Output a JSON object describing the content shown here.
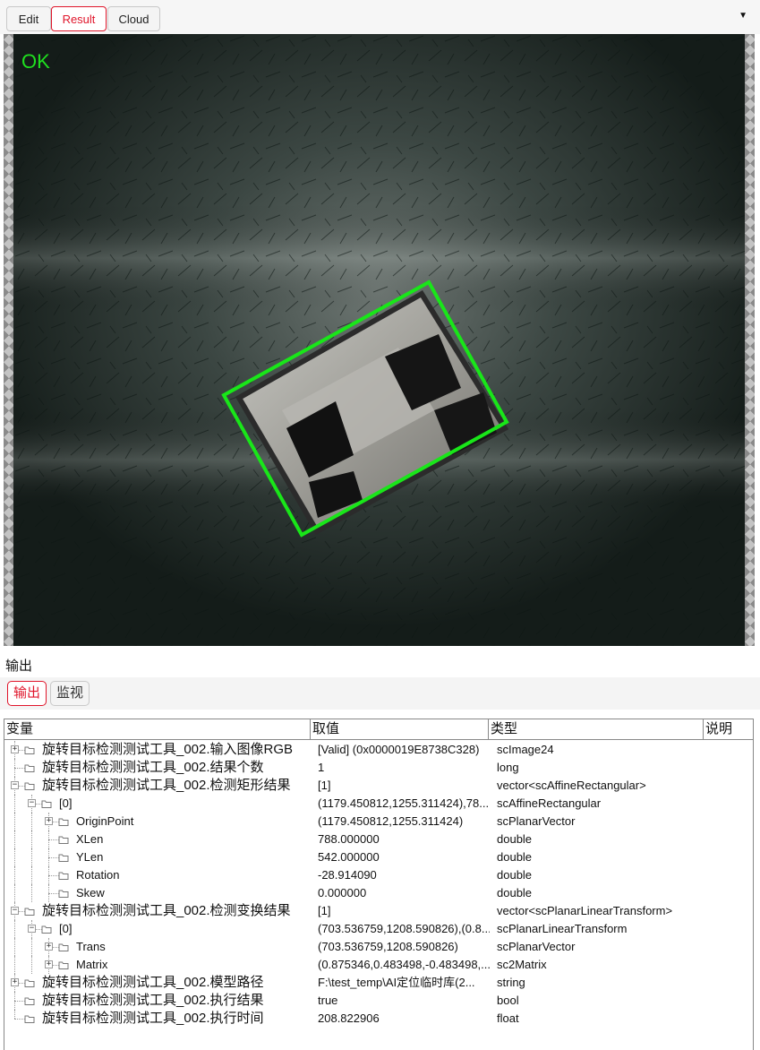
{
  "tabs": [
    {
      "label": "Edit",
      "active": false
    },
    {
      "label": "Result",
      "active": true
    },
    {
      "label": "Cloud",
      "active": false
    }
  ],
  "dropdown_icon": "chevron-down-icon",
  "viewer": {
    "status_text": "OK",
    "status_color": "#1fe01f",
    "box_color": "#19e619",
    "background_color": "#1f2a26"
  },
  "output": {
    "section_title": "输出",
    "subtabs": [
      {
        "label": "输出",
        "active": true
      },
      {
        "label": "监视",
        "active": false
      }
    ],
    "columns": [
      "变量",
      "取值",
      "类型",
      "说明"
    ],
    "rows": [
      {
        "name": "旋转目标检测测试工具_002.输入图像RGB",
        "value": "[Valid] (0x0000019E8738C328)",
        "type": "scImage24",
        "expandable": true,
        "expanded": false
      },
      {
        "name": "旋转目标检测测试工具_002.结果个数",
        "value": "1",
        "type": "long",
        "expandable": false,
        "expanded": false
      },
      {
        "name": "旋转目标检测测试工具_002.检测矩形结果",
        "value": "[1]",
        "type": "vector<scAffineRectangular>",
        "expandable": true,
        "expanded": true
      },
      {
        "name": "[0]",
        "value": "(1179.450812,1255.311424),78...",
        "type": "scAffineRectangular",
        "expandable": true,
        "expanded": true
      },
      {
        "name": "OriginPoint",
        "value": "(1179.450812,1255.311424)",
        "type": "scPlanarVector",
        "expandable": true,
        "expanded": false
      },
      {
        "name": "XLen",
        "value": "788.000000",
        "type": "double",
        "expandable": false,
        "expanded": false
      },
      {
        "name": "YLen",
        "value": "542.000000",
        "type": "double",
        "expandable": false,
        "expanded": false
      },
      {
        "name": "Rotation",
        "value": "-28.914090",
        "type": "double",
        "expandable": false,
        "expanded": false
      },
      {
        "name": "Skew",
        "value": "0.000000",
        "type": "double",
        "expandable": false,
        "expanded": false
      },
      {
        "name": "旋转目标检测测试工具_002.检测变换结果",
        "value": "[1]",
        "type": "vector<scPlanarLinearTransform>",
        "expandable": true,
        "expanded": true
      },
      {
        "name": "[0]",
        "value": "(703.536759,1208.590826),(0.8...",
        "type": "scPlanarLinearTransform",
        "expandable": true,
        "expanded": true
      },
      {
        "name": "Trans",
        "value": "(703.536759,1208.590826)",
        "type": "scPlanarVector",
        "expandable": true,
        "expanded": false
      },
      {
        "name": "Matrix",
        "value": "(0.875346,0.483498,-0.483498,...",
        "type": "sc2Matrix",
        "expandable": true,
        "expanded": false
      },
      {
        "name": "旋转目标检测测试工具_002.模型路径",
        "value": "F:\\test_temp\\AI定位临时库(2...",
        "type": "string",
        "expandable": true,
        "expanded": false
      },
      {
        "name": "旋转目标检测测试工具_002.执行结果",
        "value": "true",
        "type": "bool",
        "expandable": false,
        "expanded": false
      },
      {
        "name": "旋转目标检测测试工具_002.执行时间",
        "value": "208.822906",
        "type": "float",
        "expandable": false,
        "expanded": false
      }
    ]
  }
}
